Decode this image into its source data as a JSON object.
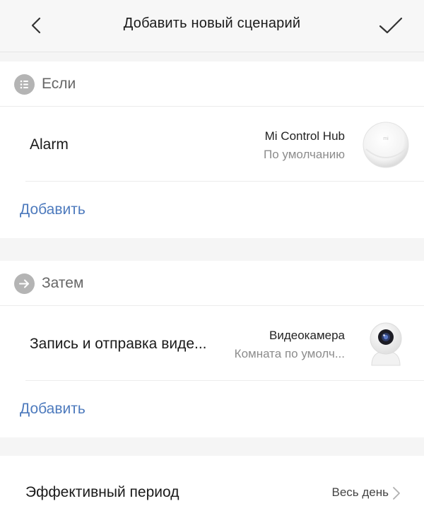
{
  "header": {
    "title": "Добавить новый сценарий",
    "back_icon": "chevron-left-icon",
    "confirm_icon": "checkmark-icon"
  },
  "if_section": {
    "label": "Если",
    "icon": "list-icon",
    "item": {
      "title": "Alarm",
      "device_name": "Mi Control Hub",
      "device_room": "По умолчанию",
      "device_icon": "hub-device-icon"
    },
    "add_label": "Добавить"
  },
  "then_section": {
    "label": "Затем",
    "icon": "arrow-right-icon",
    "item": {
      "title": "Запись и отправка виде...",
      "device_name": "Видеокамера",
      "device_room": "Комната по умолч...",
      "device_icon": "camera-device-icon"
    },
    "add_label": "Добавить"
  },
  "period": {
    "label": "Эффективный период",
    "value": "Весь день",
    "icon": "chevron-right-icon"
  },
  "colors": {
    "accent_link": "#4d7abd",
    "section_icon_bg": "#b4b4b4",
    "background": "#f5f5f5"
  }
}
